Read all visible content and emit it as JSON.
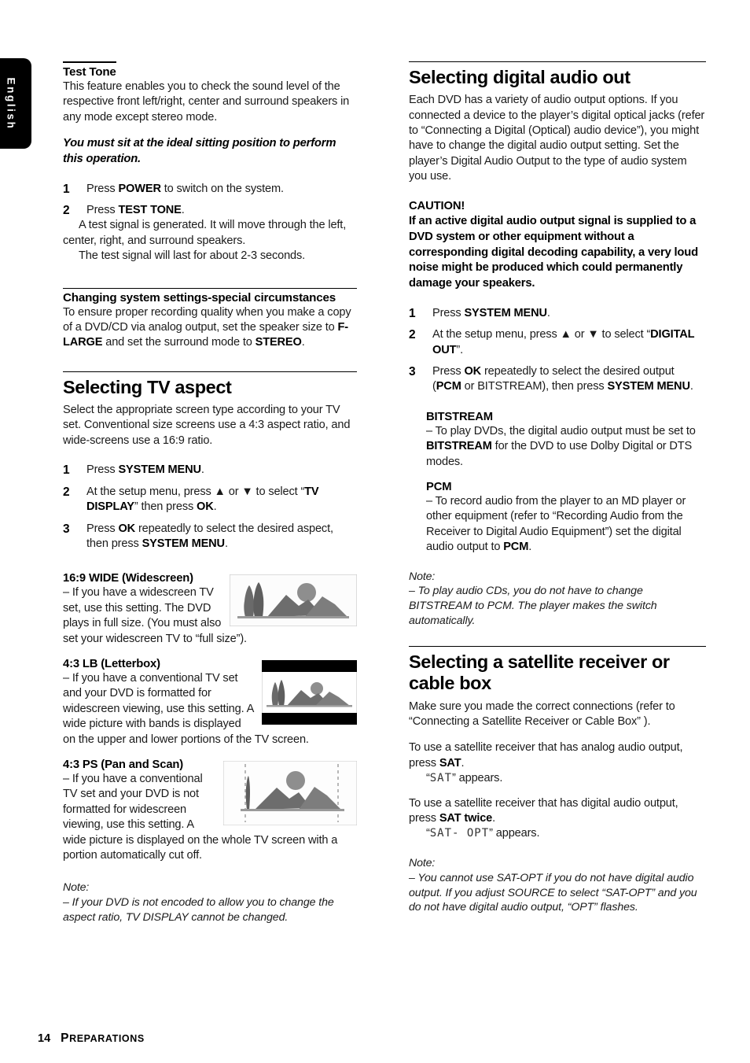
{
  "side_tab": {
    "label": "English"
  },
  "left_column": {
    "test_tone": {
      "heading": "Test Tone",
      "intro": "This feature enables you to check the sound level of the respective front left/right, center and surround speakers in any mode except stereo mode.",
      "emphasis": "You must sit at the ideal sitting position to perform this operation.",
      "steps": [
        {
          "number": "1",
          "pre": "Press ",
          "bold": "POWER",
          "post": " to switch on the system."
        },
        {
          "number": "2",
          "pre": "Press ",
          "bold": "TEST TONE",
          "post": ".",
          "sub_lines": [
            "A test signal is generated.  It will move through the left, center, right, and surround speakers.",
            "The test signal will last for about 2-3 seconds."
          ]
        }
      ]
    },
    "changing_settings": {
      "heading": "Changing system settings-special circumstances",
      "body_pre": "To ensure proper recording quality when you make a copy of a DVD/CD via analog output, set the speaker size to ",
      "body_bold1": "F-LARGE",
      "body_mid": " and set the surround mode to ",
      "body_bold2": "STEREO",
      "body_post": "."
    },
    "tv_aspect": {
      "heading": "Selecting TV aspect",
      "intro": "Select the appropriate screen type according to your TV set. Conventional size screens use a 4:3 aspect ratio, and wide-screens use a 16:9 ratio.",
      "steps": [
        {
          "number": "1",
          "pre": "Press ",
          "bold": "SYSTEM MENU",
          "post": "."
        },
        {
          "number": "2",
          "pre": "At the setup menu, press ",
          "arrow_up": "▲",
          "mid": " or ",
          "arrow_down": "▼",
          "mid2": " to select “",
          "bold": "TV DISPLAY",
          "mid3": "” then press ",
          "bold2": "OK",
          "post": "."
        },
        {
          "number": "3",
          "pre": "Press ",
          "bold": "OK",
          "mid": " repeatedly to select the desired aspect, then press ",
          "bold2": "SYSTEM MENU",
          "post": "."
        }
      ],
      "options": [
        {
          "title": "16:9 WIDE (Widescreen)",
          "text": "–   If you have a widescreen TV set, use this setting. The DVD plays in full size. (You must also set your widescreen TV to “full size”).",
          "image": "widescreen-landscape-thumbnail"
        },
        {
          "title": "4:3 LB (Letterbox)",
          "text": "–   If you have a conventional TV set and your DVD is formatted for widescreen viewing, use this setting. A wide picture with bands is displayed on the upper and lower portions of the TV screen.",
          "image": "letterbox-landscape-thumbnail"
        },
        {
          "title": "4:3 PS (Pan and Scan)",
          "text": "–   If you have a conventional TV set and your DVD is not formatted for widescreen viewing, use this setting.  A wide picture is displayed on the whole TV screen with a portion automatically cut off.",
          "image": "panscan-landscape-thumbnail"
        }
      ],
      "note": {
        "label": "Note:",
        "text": "–  If your DVD is not encoded to allow you to change the aspect ratio, TV DISPLAY cannot be changed."
      }
    }
  },
  "right_column": {
    "digital_audio": {
      "heading": "Selecting digital audio out",
      "intro": "Each DVD has a variety of audio output options. If you connected a device to the player’s digital optical jacks (refer to “Connecting a Digital (Optical) audio device”), you might have to change the digital audio output setting. Set the player’s Digital Audio Output to the type of audio system you use.",
      "caution_title": "CAUTION!",
      "caution_body": "If an active digital audio output signal is supplied to a DVD system or other equipment without a corresponding digital decoding capability, a very loud noise might be produced which could permanently damage your speakers.",
      "steps": [
        {
          "number": "1",
          "pre": "Press ",
          "bold": "SYSTEM MENU",
          "post": "."
        },
        {
          "number": "2",
          "pre": "At the setup menu, press ",
          "arrow_up": "▲",
          "mid": " or ",
          "arrow_down": "▼",
          "mid2": " to select “",
          "bold": "DIGITAL OUT",
          "post": "”."
        },
        {
          "number": "3",
          "pre": "Press ",
          "bold": "OK",
          "mid": " repeatedly to select the desired output (",
          "bold2": "PCM",
          "mid3": " or ",
          "bold3": "BITSTREAM",
          "mid4": "), then press ",
          "bold4": "SYSTEM MENU",
          "post": "."
        }
      ],
      "bitstream": {
        "title": "BITSTREAM",
        "text_pre": "–   To play DVDs, the digital audio output must be set to ",
        "text_bold": "BITSTREAM",
        "text_post": " for the DVD to use Dolby Digital or DTS modes."
      },
      "pcm": {
        "title": "PCM",
        "text_pre": "–   To record audio from the player to an MD player or other equipment (refer to “Recording Audio from the Receiver to Digital Audio Equipment”) set the digital audio output to ",
        "text_bold": "PCM",
        "text_post": "."
      },
      "note": {
        "label": "Note:",
        "text": "–  To play audio CDs, you do not have to change BITSTREAM to PCM. The player makes the switch automatically."
      }
    },
    "satellite": {
      "heading": "Selecting a satellite receiver or cable box",
      "intro": "Make sure you made the correct connections (refer to “Connecting a Satellite Receiver or Cable Box” ).",
      "analog_pre": "To use a satellite receiver that has analog audio output, press ",
      "analog_bold": "SAT",
      "analog_post": ".",
      "analog_display_pre": "“",
      "analog_display_lcd": "SAT",
      "analog_display_post": "” appears.",
      "digital_pre": "To use a satellite receiver that has digital audio output, press ",
      "digital_bold": "SAT twice",
      "digital_post": ".",
      "digital_display_pre": "“",
      "digital_display_lcd": "SAT- OPT",
      "digital_display_post": "” appears.",
      "note": {
        "label": "Note:",
        "text": "–  You cannot use SAT-OPT if you do not have digital audio output. If you adjust SOURCE to select “SAT-OPT” and you do not have digital audio output, “OPT” flashes."
      }
    }
  },
  "footer": {
    "page_number": "14",
    "section_first_letter": "P",
    "section_rest": "REPARATIONS"
  }
}
